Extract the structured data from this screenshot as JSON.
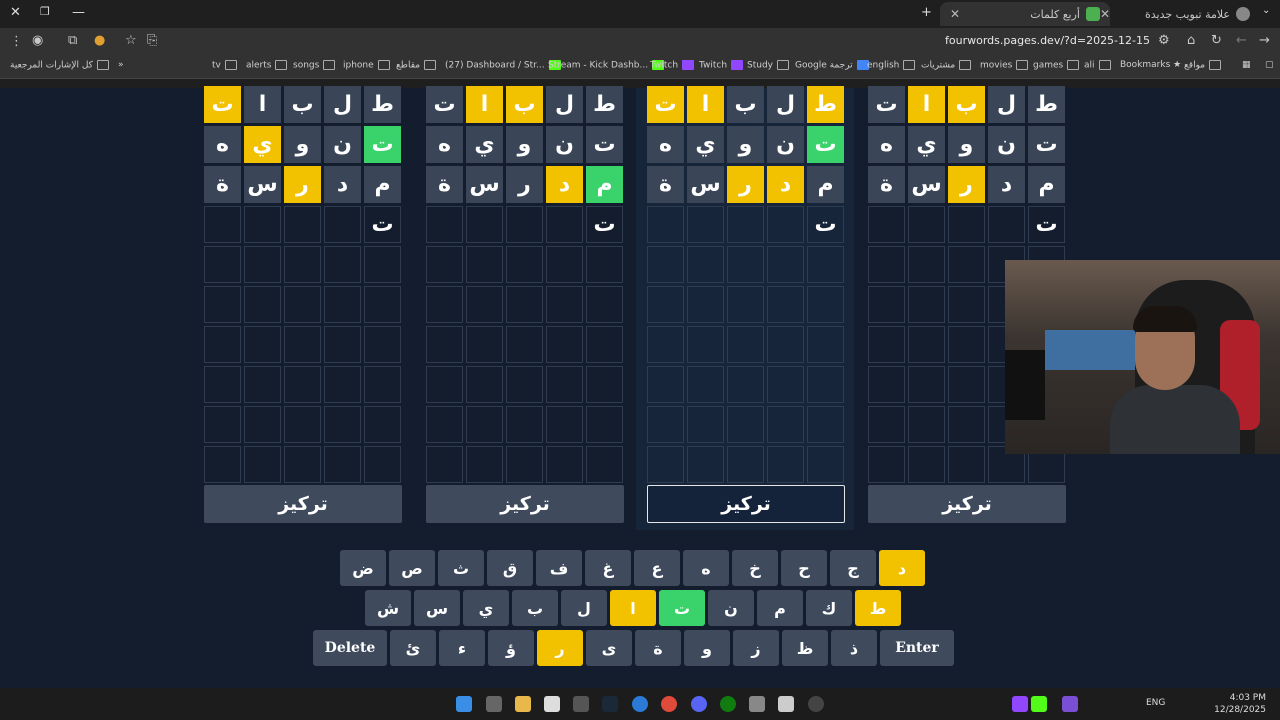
{
  "browser": {
    "tabs": [
      {
        "title": "علامة تبويب جديدة",
        "icon": "chrome-icon"
      },
      {
        "title": "أربع كلمات",
        "icon": "wordgame-icon"
      }
    ],
    "url": "fourwords.pages.dev/?d=2025-12-15",
    "bookmarks": [
      "Bookmarks",
      "مواقع",
      "ali",
      "games",
      "movies",
      "مشتريات",
      "english",
      "Google ترجمة",
      "Study",
      "Twitch",
      "Twitch",
      "Stream - Kick Dashb...",
      "(27) Dashboard / Str...",
      "مقاطع",
      "iphone",
      "songs",
      "alerts",
      "tv"
    ],
    "all_bookmarks": "كل الإشارات المرجعية"
  },
  "game": {
    "focus_label": "تركيز",
    "boards": [
      {
        "rows": [
          [
            {
              "l": "ت",
              "s": "yellow"
            },
            {
              "l": "ا",
              "s": "gray"
            },
            {
              "l": "ب",
              "s": "gray"
            },
            {
              "l": "ل",
              "s": "gray"
            },
            {
              "l": "ط",
              "s": "gray"
            }
          ],
          [
            {
              "l": "ه",
              "s": "gray"
            },
            {
              "l": "ي",
              "s": "yellow"
            },
            {
              "l": "و",
              "s": "gray"
            },
            {
              "l": "ن",
              "s": "gray"
            },
            {
              "l": "ت",
              "s": "green"
            }
          ],
          [
            {
              "l": "ة",
              "s": "gray"
            },
            {
              "l": "س",
              "s": "gray"
            },
            {
              "l": "ر",
              "s": "yellow"
            },
            {
              "l": "د",
              "s": "gray"
            },
            {
              "l": "م",
              "s": "gray"
            }
          ],
          [
            {
              "l": "",
              "s": "typed"
            },
            {
              "l": "",
              "s": "typed"
            },
            {
              "l": "",
              "s": "typed"
            },
            {
              "l": "",
              "s": "typed"
            },
            {
              "l": "ت",
              "s": "typed"
            }
          ]
        ]
      },
      {
        "rows": [
          [
            {
              "l": "ت",
              "s": "gray"
            },
            {
              "l": "ا",
              "s": "yellow"
            },
            {
              "l": "ب",
              "s": "yellow"
            },
            {
              "l": "ل",
              "s": "gray"
            },
            {
              "l": "ط",
              "s": "gray"
            }
          ],
          [
            {
              "l": "ه",
              "s": "gray"
            },
            {
              "l": "ي",
              "s": "gray"
            },
            {
              "l": "و",
              "s": "gray"
            },
            {
              "l": "ن",
              "s": "gray"
            },
            {
              "l": "ت",
              "s": "gray"
            }
          ],
          [
            {
              "l": "ة",
              "s": "gray"
            },
            {
              "l": "س",
              "s": "gray"
            },
            {
              "l": "ر",
              "s": "gray"
            },
            {
              "l": "د",
              "s": "yellow"
            },
            {
              "l": "م",
              "s": "green"
            }
          ],
          [
            {
              "l": "",
              "s": "typed"
            },
            {
              "l": "",
              "s": "typed"
            },
            {
              "l": "",
              "s": "typed"
            },
            {
              "l": "",
              "s": "typed"
            },
            {
              "l": "ت",
              "s": "typed"
            }
          ]
        ]
      },
      {
        "rows": [
          [
            {
              "l": "ت",
              "s": "yellow"
            },
            {
              "l": "ا",
              "s": "yellow"
            },
            {
              "l": "ب",
              "s": "gray"
            },
            {
              "l": "ل",
              "s": "gray"
            },
            {
              "l": "ط",
              "s": "yellow"
            }
          ],
          [
            {
              "l": "ه",
              "s": "gray"
            },
            {
              "l": "ي",
              "s": "gray"
            },
            {
              "l": "و",
              "s": "gray"
            },
            {
              "l": "ن",
              "s": "gray"
            },
            {
              "l": "ت",
              "s": "green"
            }
          ],
          [
            {
              "l": "ة",
              "s": "gray"
            },
            {
              "l": "س",
              "s": "gray"
            },
            {
              "l": "ر",
              "s": "yellow"
            },
            {
              "l": "د",
              "s": "yellow"
            },
            {
              "l": "م",
              "s": "gray"
            }
          ],
          [
            {
              "l": "",
              "s": "typed"
            },
            {
              "l": "",
              "s": "typed"
            },
            {
              "l": "",
              "s": "typed"
            },
            {
              "l": "",
              "s": "typed"
            },
            {
              "l": "ت",
              "s": "typed"
            }
          ]
        ]
      },
      {
        "rows": [
          [
            {
              "l": "ت",
              "s": "gray"
            },
            {
              "l": "ا",
              "s": "yellow"
            },
            {
              "l": "ب",
              "s": "yellow"
            },
            {
              "l": "ل",
              "s": "gray"
            },
            {
              "l": "ط",
              "s": "gray"
            }
          ],
          [
            {
              "l": "ه",
              "s": "gray"
            },
            {
              "l": "ي",
              "s": "gray"
            },
            {
              "l": "و",
              "s": "gray"
            },
            {
              "l": "ن",
              "s": "gray"
            },
            {
              "l": "ت",
              "s": "gray"
            }
          ],
          [
            {
              "l": "ة",
              "s": "gray"
            },
            {
              "l": "س",
              "s": "gray"
            },
            {
              "l": "ر",
              "s": "yellow"
            },
            {
              "l": "د",
              "s": "gray"
            },
            {
              "l": "م",
              "s": "gray"
            }
          ],
          [
            {
              "l": "",
              "s": "typed"
            },
            {
              "l": "",
              "s": "typed"
            },
            {
              "l": "",
              "s": "typed"
            },
            {
              "l": "",
              "s": "typed"
            },
            {
              "l": "ت",
              "s": "typed"
            }
          ]
        ]
      }
    ],
    "keyboard": {
      "row1": [
        {
          "l": "ض",
          "s": "gray"
        },
        {
          "l": "ص",
          "s": "gray"
        },
        {
          "l": "ث",
          "s": "gray"
        },
        {
          "l": "ق",
          "s": "gray"
        },
        {
          "l": "ف",
          "s": "gray"
        },
        {
          "l": "غ",
          "s": "gray"
        },
        {
          "l": "ع",
          "s": "gray"
        },
        {
          "l": "ه",
          "s": "gray"
        },
        {
          "l": "خ",
          "s": "gray"
        },
        {
          "l": "ح",
          "s": "gray"
        },
        {
          "l": "ج",
          "s": "gray"
        },
        {
          "l": "د",
          "s": "yellow"
        }
      ],
      "row2": [
        {
          "l": "ش",
          "s": "gray"
        },
        {
          "l": "س",
          "s": "gray"
        },
        {
          "l": "ي",
          "s": "gray"
        },
        {
          "l": "ب",
          "s": "gray"
        },
        {
          "l": "ل",
          "s": "gray"
        },
        {
          "l": "ا",
          "s": "yellow"
        },
        {
          "l": "ت",
          "s": "green"
        },
        {
          "l": "ن",
          "s": "gray"
        },
        {
          "l": "م",
          "s": "gray"
        },
        {
          "l": "ك",
          "s": "gray"
        },
        {
          "l": "ط",
          "s": "yellow"
        }
      ],
      "row3": [
        {
          "l": "Delete",
          "s": "wide"
        },
        {
          "l": "ئ",
          "s": "gray"
        },
        {
          "l": "ء",
          "s": "gray"
        },
        {
          "l": "ؤ",
          "s": "gray"
        },
        {
          "l": "ر",
          "s": "yellow"
        },
        {
          "l": "ى",
          "s": "gray"
        },
        {
          "l": "ة",
          "s": "gray"
        },
        {
          "l": "و",
          "s": "gray"
        },
        {
          "l": "ز",
          "s": "gray"
        },
        {
          "l": "ظ",
          "s": "gray"
        },
        {
          "l": "ذ",
          "s": "gray"
        },
        {
          "l": "Enter",
          "s": "wide"
        }
      ]
    }
  },
  "taskbar": {
    "time": "4:03 PM",
    "date": "12/28/2025",
    "lang": "ENG"
  }
}
